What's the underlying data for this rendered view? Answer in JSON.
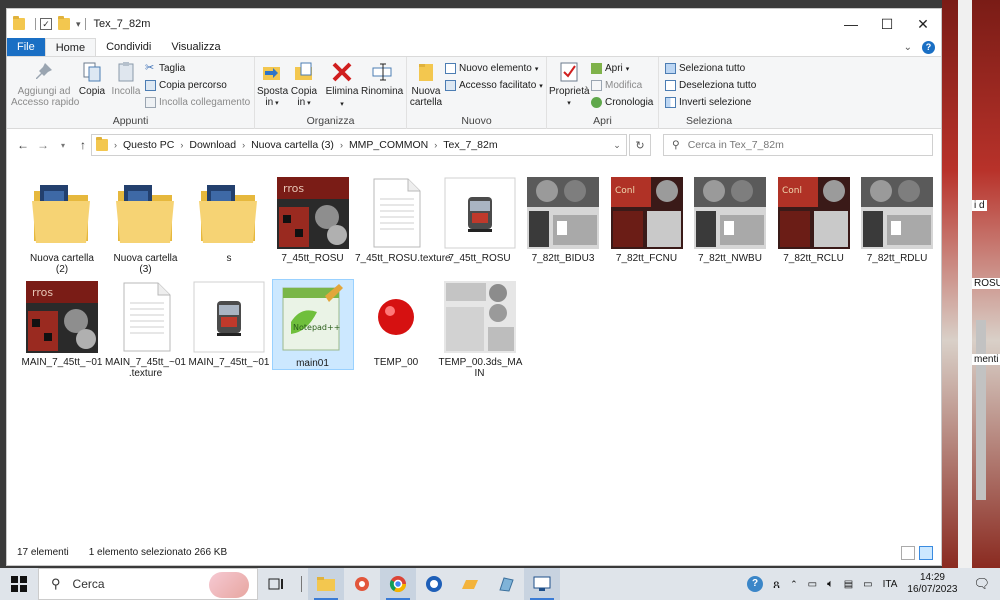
{
  "window": {
    "title": "Tex_7_82m",
    "controls": {
      "minimize": "—",
      "maximize": "☐",
      "close": "✕"
    }
  },
  "tabs": {
    "file": "File",
    "home": "Home",
    "share": "Condividi",
    "view": "Visualizza"
  },
  "ribbon": {
    "clipboard": {
      "label": "Appunti",
      "pin": "Aggiungi ad\nAccesso rapido",
      "copy": "Copia",
      "paste": "Incolla",
      "cut": "Taglia",
      "copy_path": "Copia percorso",
      "paste_link": "Incolla collegamento"
    },
    "organize": {
      "label": "Organizza",
      "move": "Sposta\nin",
      "copy_to": "Copia\nin",
      "delete": "Elimina",
      "rename": "Rinomina"
    },
    "new": {
      "label": "Nuovo",
      "new_folder": "Nuova\ncartella",
      "new_item": "Nuovo elemento",
      "easy_access": "Accesso facilitato"
    },
    "open": {
      "label": "Apri",
      "properties": "Proprietà",
      "open": "Apri",
      "edit": "Modifica",
      "history": "Cronologia"
    },
    "select": {
      "label": "Seleziona",
      "all": "Seleziona tutto",
      "none": "Deseleziona tutto",
      "invert": "Inverti selezione"
    }
  },
  "address": {
    "crumbs": [
      "Questo PC",
      "Download",
      "Nuova cartella (3)",
      "MMP_COMMON",
      "Tex_7_82m"
    ],
    "search_placeholder": "Cerca in Tex_7_82m"
  },
  "files": [
    {
      "name": "Nuova cartella\n(2)",
      "kind": "folder"
    },
    {
      "name": "Nuova cartella\n(3)",
      "kind": "folder"
    },
    {
      "name": "s",
      "kind": "folder"
    },
    {
      "name": "7_45tt_ROSU",
      "kind": "tex"
    },
    {
      "name": "7_45tt_ROSU.texture",
      "kind": "doc"
    },
    {
      "name": "7_45tt_ROSU",
      "kind": "train"
    },
    {
      "name": "7_82tt_BIDU3",
      "kind": "tex2"
    },
    {
      "name": "7_82tt_FCNU",
      "kind": "tex3"
    },
    {
      "name": "7_82tt_NWBU",
      "kind": "tex2"
    },
    {
      "name": "7_82tt_RCLU",
      "kind": "tex3"
    },
    {
      "name": "7_82tt_RDLU",
      "kind": "tex2"
    },
    {
      "name": "MAIN_7_45tt_~01",
      "kind": "tex"
    },
    {
      "name": "MAIN_7_45tt_~01\n.texture",
      "kind": "doc"
    },
    {
      "name": "MAIN_7_45tt_~01",
      "kind": "train"
    },
    {
      "name": "main01",
      "kind": "notepad",
      "selected": true
    },
    {
      "name": "TEMP_00",
      "kind": "ball"
    },
    {
      "name": "TEMP_00.3ds_MA\nIN",
      "kind": "grey"
    }
  ],
  "status": {
    "count": "17 elementi",
    "selection": "1 elemento selezionato 266 KB"
  },
  "background_texts": [
    "i d",
    "ROSU",
    "menti"
  ],
  "taskbar": {
    "search": "Cerca",
    "lang": "ITA",
    "time": "14:29",
    "date": "16/07/2023"
  }
}
